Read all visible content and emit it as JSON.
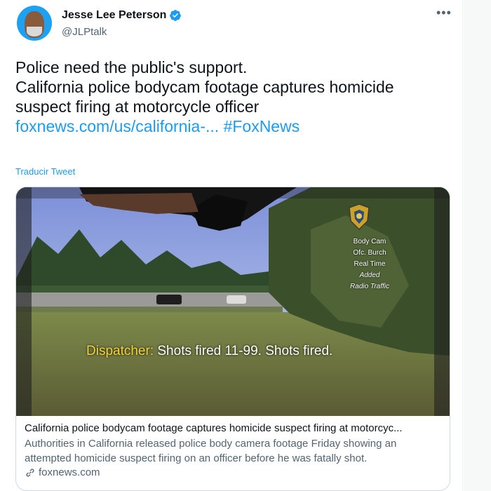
{
  "author": {
    "name": "Jesse Lee Peterson",
    "handle": "@JLPtalk"
  },
  "tweet": {
    "line1": "Police need the public's support.",
    "line2a": "California police bodycam footage captures homicide",
    "line2b": "suspect firing at motorcycle officer",
    "link_text": "foxnews.com/us/california-...",
    "hashtag": "#FoxNews",
    "translate": "Traducir Tweet"
  },
  "video": {
    "overlay": {
      "l1": "Body Cam",
      "l2": "Ofc. Burch",
      "l3": "Real Time",
      "l4": "Added",
      "l5": "Radio Traffic"
    },
    "subtitle_label": "Dispatcher:",
    "subtitle_text": " Shots fired 11-99. Shots fired."
  },
  "card": {
    "title": "California police bodycam footage captures homicide suspect firing at motorcyc...",
    "desc": "Authorities in California released police body camera footage Friday showing an attempted homicide suspect firing on an officer before he was fatally shot.",
    "domain": "foxnews.com"
  },
  "colors": {
    "link": "#1d9bf0",
    "subtitle_label": "#f5d33a",
    "verified": "#1d9bf0"
  },
  "icons": {
    "verified": "verified-badge-icon",
    "more": "more-options-icon",
    "link": "link-icon"
  }
}
